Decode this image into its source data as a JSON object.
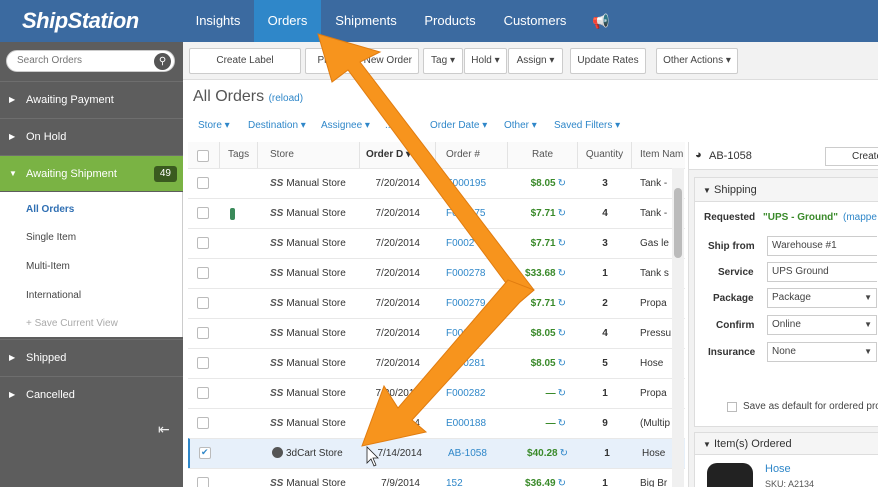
{
  "app": {
    "brand": "ShipStation"
  },
  "nav": {
    "items": [
      {
        "label": "Insights"
      },
      {
        "label": "Orders"
      },
      {
        "label": "Shipments"
      },
      {
        "label": "Products"
      },
      {
        "label": "Customers"
      }
    ],
    "announce_icon": "megaphone-icon"
  },
  "sidebar": {
    "search_placeholder": "Search Orders",
    "groups": [
      {
        "label": "Awaiting Payment"
      },
      {
        "label": "On Hold"
      },
      {
        "label": "Awaiting Shipment",
        "badge": "49"
      },
      {
        "label": "Shipped"
      },
      {
        "label": "Cancelled"
      }
    ],
    "subitems": [
      {
        "label": "All Orders"
      },
      {
        "label": "Single Item"
      },
      {
        "label": "Multi-Item"
      },
      {
        "label": "International"
      },
      {
        "label": "Save Current View"
      }
    ]
  },
  "toolbar": {
    "create_label": "Create Label",
    "print": "Pr",
    "new_order": "New Order",
    "tag": "Tag",
    "hold": "Hold",
    "assign": "Assign",
    "update_rates": "Update Rates",
    "other_actions": "Other Actions"
  },
  "main": {
    "title": "All Orders",
    "reload": "(reload)",
    "filters": [
      "Store",
      "Destination",
      "Assignee",
      "...",
      "Order Date",
      "Other",
      "Saved Filters"
    ]
  },
  "table": {
    "headers": [
      "Tags",
      "Store",
      "Order D",
      "Order #",
      "Rate",
      "Quantity",
      "Item Nam"
    ],
    "rows": [
      {
        "store": "Manual Store",
        "date": "7/20/2014",
        "order": "E000195",
        "rate": "$8.05",
        "qty": "3",
        "item": "Tank -",
        "checked": false,
        "tag": false,
        "icon": "ss"
      },
      {
        "store": "Manual Store",
        "date": "7/20/2014",
        "order": "F000275",
        "rate": "$7.71",
        "qty": "4",
        "item": "Tank -",
        "checked": false,
        "tag": true,
        "icon": "ss"
      },
      {
        "store": "Manual Store",
        "date": "7/20/2014",
        "order": "F0002",
        "rate": "$7.71",
        "qty": "3",
        "item": "Gas le",
        "checked": false,
        "tag": false,
        "icon": "ss"
      },
      {
        "store": "Manual Store",
        "date": "7/20/2014",
        "order": "F000278",
        "rate": "$33.68",
        "qty": "1",
        "item": "Tank s",
        "checked": false,
        "tag": false,
        "icon": "ss"
      },
      {
        "store": "Manual Store",
        "date": "7/20/2014",
        "order": "F000279",
        "rate": "$7.71",
        "qty": "2",
        "item": "Propa",
        "checked": false,
        "tag": false,
        "icon": "ss"
      },
      {
        "store": "Manual Store",
        "date": "7/20/2014",
        "order": "F00028",
        "rate": "$8.05",
        "qty": "4",
        "item": "Pressu",
        "checked": false,
        "tag": false,
        "icon": "ss"
      },
      {
        "store": "Manual Store",
        "date": "7/20/2014",
        "order": "F000281",
        "rate": "$8.05",
        "qty": "5",
        "item": "Hose",
        "checked": false,
        "tag": false,
        "icon": "ss"
      },
      {
        "store": "Manual Store",
        "date": "7/20/2014",
        "order": "F000282",
        "rate": "—",
        "qty": "1",
        "item": "Propa",
        "checked": false,
        "tag": false,
        "icon": "ss"
      },
      {
        "store": "Manual Store",
        "date": "7/20/2014",
        "order": "E000188",
        "rate": "—",
        "qty": "9",
        "item": "(Multip",
        "checked": false,
        "tag": false,
        "icon": "ss"
      },
      {
        "store": "3dCart Store",
        "date": "7/14/2014",
        "order": "AB-1058",
        "rate": "$40.28",
        "qty": "1",
        "item": "Hose",
        "checked": true,
        "tag": false,
        "icon": "cart"
      },
      {
        "store": "Manual Store",
        "date": "7/9/2014",
        "order": "152",
        "rate": "$36.49",
        "qty": "1",
        "item": "Big Br",
        "checked": false,
        "tag": false,
        "icon": "ss"
      }
    ]
  },
  "panel": {
    "order_no": "AB-1058",
    "create_btn": "Create",
    "shipping_title": "Shipping",
    "requested_label": "Requested",
    "requested_value": "\"UPS - Ground\"",
    "mapped": "(mappe",
    "ship_from_label": "Ship from",
    "ship_from_value": "Warehouse #1",
    "service_label": "Service",
    "service_value": "UPS Ground",
    "package_label": "Package",
    "package_value": "Package",
    "confirm_label": "Confirm",
    "confirm_value": "Online",
    "insurance_label": "Insurance",
    "insurance_value": "None",
    "save_default": "Save as default for ordered pro",
    "items_title": "Item(s) Ordered",
    "item_name": "Hose",
    "item_sku": "SKU: A2134"
  },
  "colors": {
    "nav": "#3b6aa0",
    "nav_active": "#2f87c9",
    "sidebar": "#5d5d5d",
    "green": "#7ab344",
    "arrow": "#f7941d"
  }
}
